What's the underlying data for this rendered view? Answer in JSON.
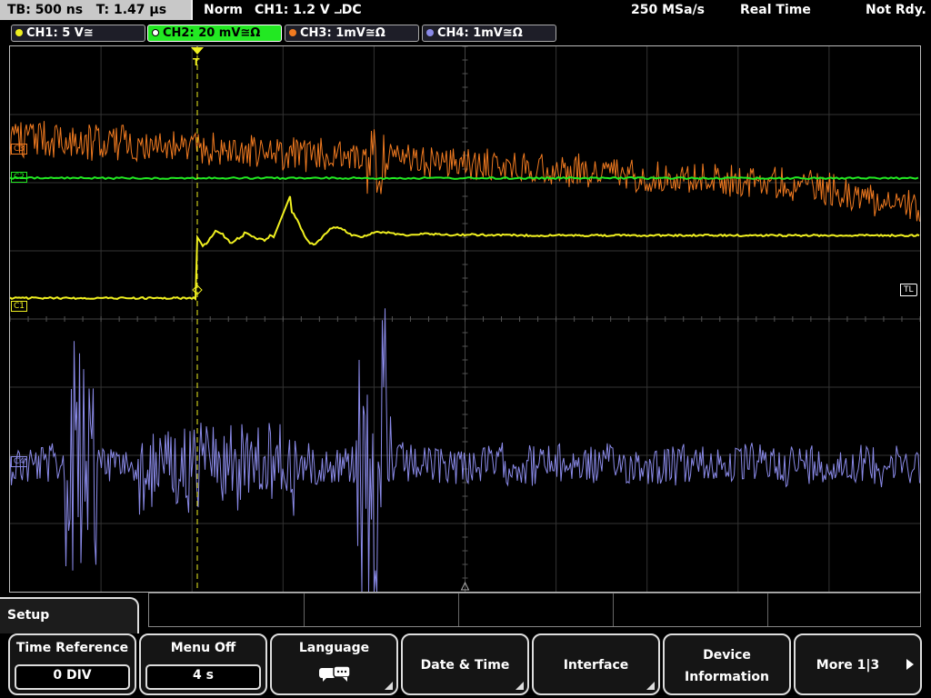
{
  "status": {
    "timebase": "TB: 500 ns",
    "trigger_time": "T: 1.47 µs",
    "mode": "Norm",
    "trigger_setting": "CH1: 1.2 V ⨼DC",
    "sample_rate": "250 MSa/s",
    "acq_mode": "Real Time",
    "state": "Not Rdy."
  },
  "channels": [
    {
      "label": "CH1: 5 V≅",
      "color": "#f0f020"
    },
    {
      "label": "CH2: 20 mV≅Ω",
      "color": "#22e822"
    },
    {
      "label": "CH3: 1mV≅Ω",
      "color": "#f07a20"
    },
    {
      "label": "CH4: 1mV≅Ω",
      "color": "#8a8ae8"
    }
  ],
  "markers": {
    "c3": "C3",
    "c2": "C2",
    "c1": "C1",
    "c4": "C4",
    "trigger_level": "TL",
    "trigger_pos": "T"
  },
  "menu": {
    "title": "Setup",
    "softkeys": [
      {
        "label": "Time Reference",
        "value": "0 DIV"
      },
      {
        "label": "Menu Off",
        "value": "4 s"
      },
      {
        "label": "Language",
        "icon": "speech-bubbles-icon"
      },
      {
        "label": "Date & Time"
      },
      {
        "label": "Interface"
      },
      {
        "label_line1": "Device",
        "label_line2": "Information"
      },
      {
        "label": "More 1|3"
      }
    ]
  }
}
